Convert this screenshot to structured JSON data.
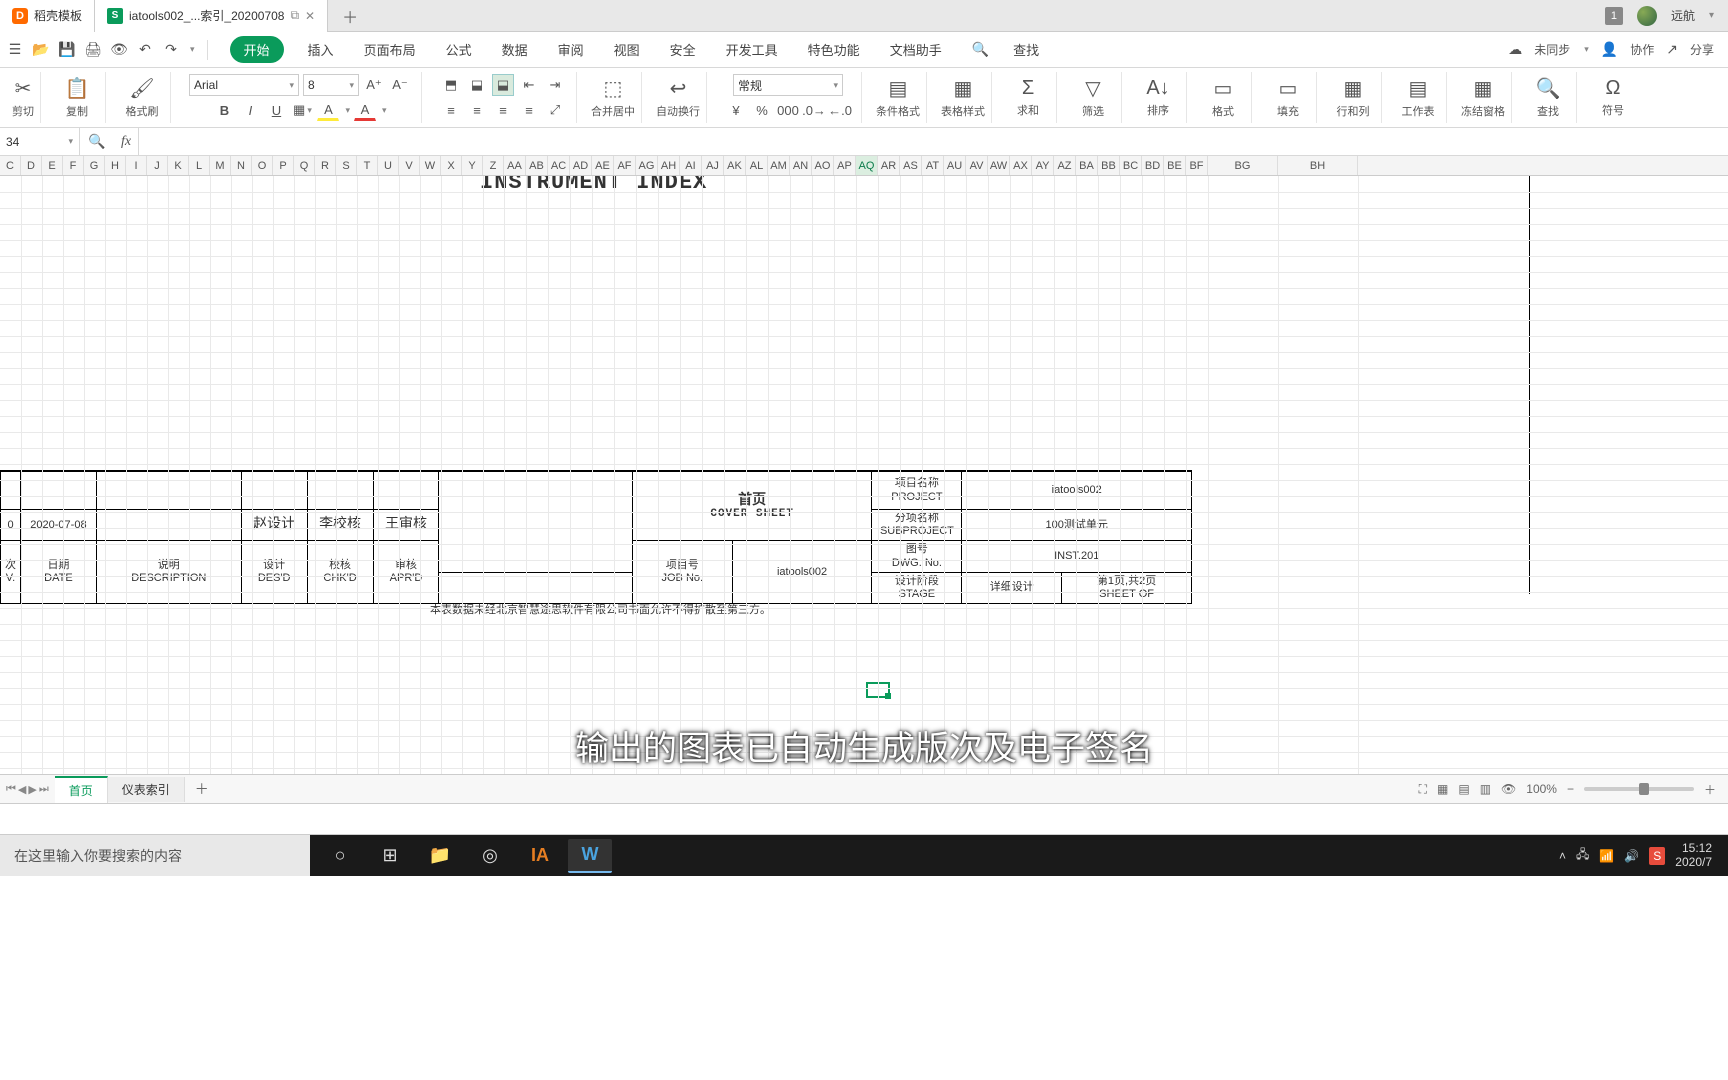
{
  "tabs": {
    "home_label": "稻壳模板",
    "doc_label": "iatools002_...索引_20200708",
    "badge": "1",
    "username": "远航"
  },
  "menus": {
    "start": "开始",
    "insert": "插入",
    "layout": "页面布局",
    "formula": "公式",
    "data": "数据",
    "review": "审阅",
    "view": "视图",
    "security": "安全",
    "dev": "开发工具",
    "special": "特色功能",
    "dochelp": "文档助手",
    "search": "查找"
  },
  "top_right": {
    "unsync": "未同步",
    "collab": "协作",
    "share": "分享"
  },
  "ribbon": {
    "cut": "剪切",
    "copy": "复制",
    "paste": "粘贴",
    "format_painter": "格式刷",
    "font_name": "Arial",
    "font_size": "8",
    "merge": "合并居中",
    "wrap": "自动换行",
    "numfmt": "常规",
    "cond_fmt": "条件格式",
    "table_style": "表格样式",
    "sum": "求和",
    "filter": "筛选",
    "sort": "排序",
    "format": "格式",
    "fill": "填充",
    "rowcol": "行和列",
    "worksheet": "工作表",
    "freeze": "冻结窗格",
    "find": "查找",
    "symbol": "符号"
  },
  "namebox": "34",
  "columns": [
    "C",
    "D",
    "E",
    "F",
    "G",
    "H",
    "I",
    "J",
    "K",
    "L",
    "M",
    "N",
    "O",
    "P",
    "Q",
    "R",
    "S",
    "T",
    "U",
    "V",
    "W",
    "X",
    "Y",
    "Z",
    "AA",
    "AB",
    "AC",
    "AD",
    "AE",
    "AF",
    "AG",
    "AH",
    "AI",
    "AJ",
    "AK",
    "AL",
    "AM",
    "AN",
    "AO",
    "AP",
    "AQ",
    "AR",
    "AS",
    "AT",
    "AU",
    "AV",
    "AW",
    "AX",
    "AY",
    "AZ",
    "BA",
    "BB",
    "BC",
    "BD",
    "BE",
    "BF",
    "BG",
    "BH"
  ],
  "selected_col": "AQ",
  "title": "INSTRUMENT INDEX",
  "titleblock": {
    "rev0": "0",
    "date0": "2020-07-08",
    "rev_h_cn": "次",
    "rev_h_en": "V.",
    "date_h_cn": "日期",
    "date_h_en": "DATE",
    "desc_h_cn": "说明",
    "desc_h_en": "DESCRIPTION",
    "des_h_cn": "设计",
    "des_h_en": "DES'D",
    "chk_h_cn": "校核",
    "chk_h_en": "CHK'D",
    "apr_h_cn": "审核",
    "apr_h_en": "APR'D",
    "sig_des": "赵设计",
    "sig_chk": "李校核",
    "sig_apr": "王审核",
    "cover_cn": "首页",
    "cover_en": "COVER SHEET",
    "jobno_h_cn": "项目号",
    "jobno_h_en": "JOB No.",
    "jobno_v": "iatools002",
    "proj_h_cn": "项目名称",
    "proj_h_en": "PROJECT",
    "proj_v": "iatools002",
    "subproj_h_cn": "分项名称",
    "subproj_h_en": "SUBPROJECT",
    "subproj_v": "100测试单元",
    "dwg_h_cn": "图号",
    "dwg_h_en": "DWG. No.",
    "dwg_v": "INST.201",
    "stage_h_cn": "设计阶段",
    "stage_h_en": "STAGE",
    "stage_v": "详细设计",
    "sheet_h_cn": "第1页,共2页",
    "sheet_h_en": "SHEET   OF"
  },
  "copyright": "本表数据未经北京智慧途思软件有限公司书面允许不得扩散至第三方。",
  "sheets": {
    "s1": "首页",
    "s2": "仪表索引"
  },
  "zoom": "100%",
  "caption": "输出的图表已自动生成版次及电子签名",
  "win": {
    "search_placeholder": "在这里输入你要搜索的内容",
    "time": "15:12",
    "date": "2020/7"
  }
}
